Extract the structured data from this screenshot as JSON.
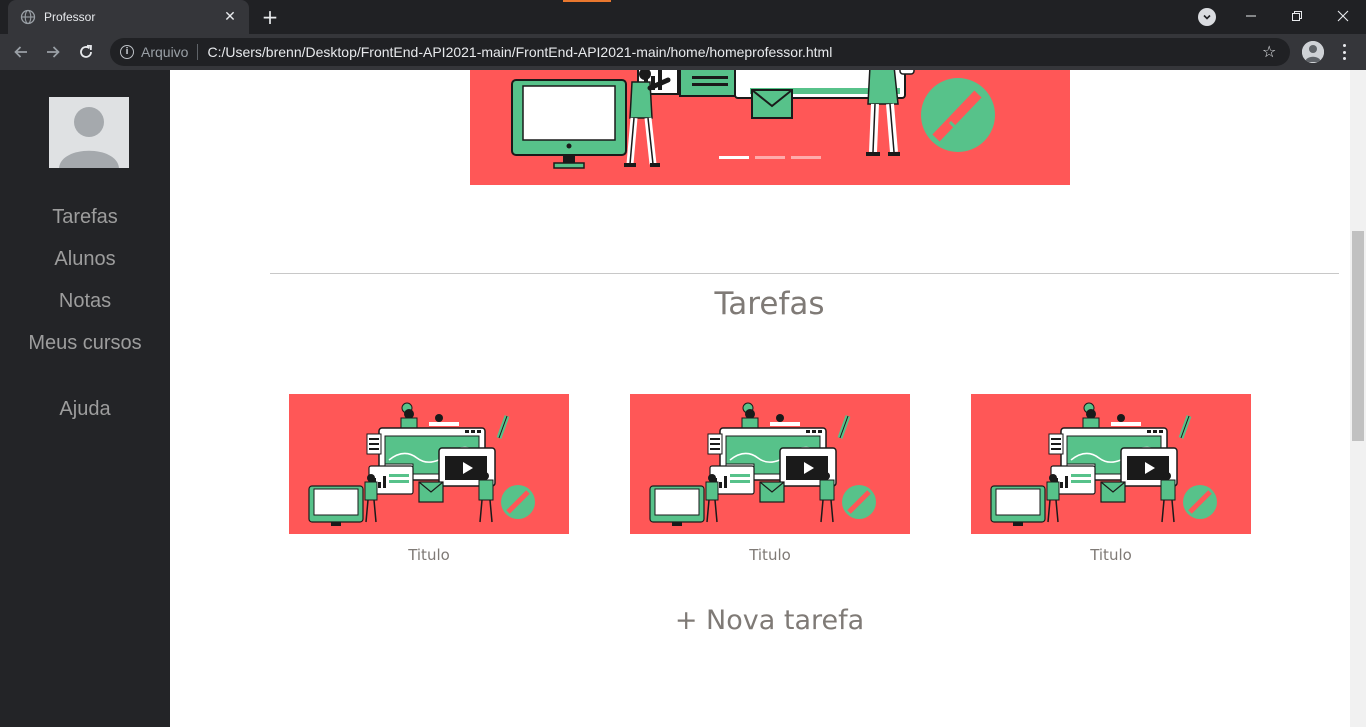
{
  "browser": {
    "tab_title": "Professor",
    "new_tab_symbol": "+",
    "close_symbol": "✕",
    "address_scheme": "Arquivo",
    "address_url": "C:/Users/brenn/Desktop/FrontEnd-API2021-main/FrontEnd-API2021-main/home/homeprofessor.html"
  },
  "sidebar": {
    "items": [
      {
        "label": "Tarefas"
      },
      {
        "label": "Alunos"
      },
      {
        "label": "Notas"
      },
      {
        "label": "Meus cursos"
      },
      {
        "label": "Ajuda"
      }
    ]
  },
  "carousel": {
    "slide_count": 3,
    "active_index": 0
  },
  "main": {
    "section_title": "Tarefas",
    "cards": [
      {
        "title": "Titulo"
      },
      {
        "title": "Titulo"
      },
      {
        "title": "Titulo"
      }
    ],
    "new_task_label": "+ Nova tarefa"
  },
  "colors": {
    "sidebar_bg": "#232427",
    "banner_red": "#ff5757",
    "illustration_green": "#57c28a",
    "text_gray": "#7f7a76"
  }
}
